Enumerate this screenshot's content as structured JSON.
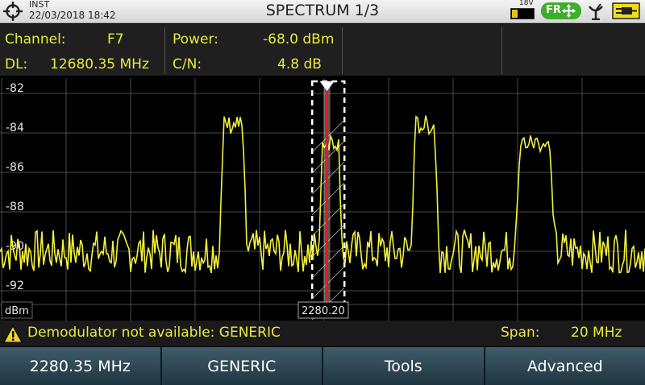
{
  "status_bar": {
    "mode": "INST",
    "datetime": "22/03/2018 18:42",
    "title": "SPECTRUM 1/3",
    "voltage": "18V",
    "badge": "FR",
    "icons": [
      "target-icon",
      "battery-icon",
      "move-arrows-icon",
      "antenna-icon",
      "power-plug-icon"
    ]
  },
  "info": {
    "channel_label": "Channel:",
    "channel_value": "F7",
    "dl_label": "DL:",
    "dl_value": "12680.35 MHz",
    "power_label": "Power:",
    "power_value": "-68.0 dBm",
    "cn_label": "C/N:",
    "cn_value": "4.8 dB"
  },
  "spectrum": {
    "y_tick_labels": [
      "-82",
      "-84",
      "-86",
      "-88",
      "-90",
      "-92"
    ],
    "unit_label": "dBm",
    "marker_label": "2280.20",
    "ylim": [
      -92,
      -82
    ],
    "trace_color": "#f2f23a",
    "marker_color": "#d81f1f",
    "signal_peaks": [
      {
        "start": 0.34,
        "end": 0.383,
        "level": -83.6
      },
      {
        "start": 0.494,
        "end": 0.531,
        "level": -84.4
      },
      {
        "start": 0.637,
        "end": 0.681,
        "level": -83.6
      },
      {
        "start": 0.797,
        "end": 0.862,
        "level": -84.5
      }
    ],
    "noise_floor": -90.0,
    "marker_position": 0.507,
    "channel_window": [
      0.484,
      0.534
    ]
  },
  "message": {
    "text": "Demodulator not available: GENERIC",
    "span_label": "Span:",
    "span_value": "20 MHz"
  },
  "softkeys": [
    "2280.35 MHz",
    "GENERIC",
    "Tools",
    "Advanced"
  ],
  "colors": {
    "text_accent": "#e6ea3e",
    "badge_green": "#3fae2a",
    "softkey_bg": "#2f4a57"
  }
}
